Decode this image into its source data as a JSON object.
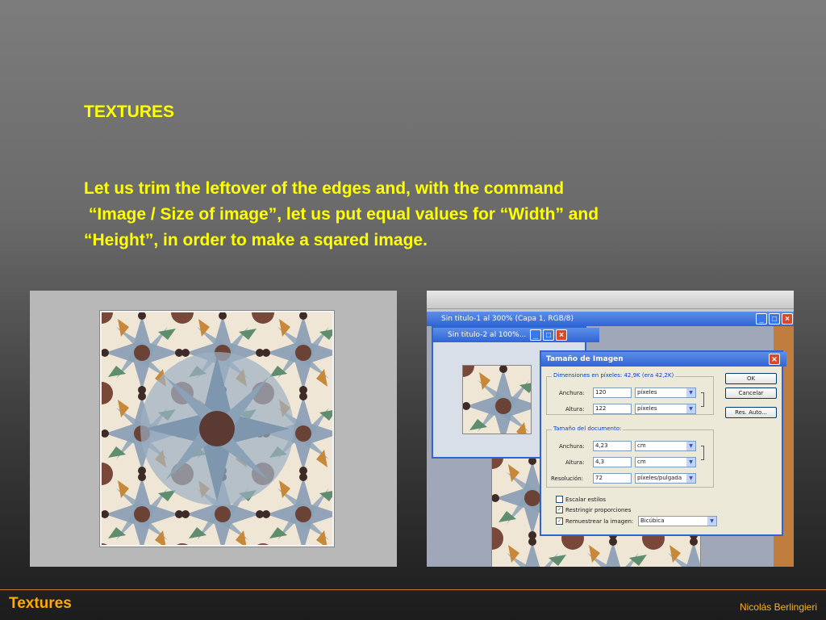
{
  "slide": {
    "title": "TEXTURES",
    "body_lines": [
      "Let us trim the leftover of the edges and, with the command",
      " “Image / Size of image”, let us put equal values for “Width” and",
      "“Height”, in order to make a sqared image."
    ]
  },
  "screenshot": {
    "window1_title": "Sin titulo-1 al 300% (Capa 1, RGB/8)",
    "window2_title": "Sin titulo-2 al 100%...",
    "dialog": {
      "title": "Tamaño de Imagen",
      "pixel_dims_label": "Dimensiones en píxeles: 42,9K (era 42,2K)",
      "width_label": "Anchura:",
      "width_px": "120",
      "height_label": "Altura:",
      "height_px": "122",
      "pixel_unit": "píxeles",
      "doc_size_label": "Tamaño del documento:",
      "doc_width": "4,23",
      "doc_height": "4,3",
      "doc_unit": "cm",
      "resolution_label": "Resolución:",
      "resolution": "72",
      "resolution_unit": "píxeles/pulgada",
      "scale_styles": "Escalar estilos",
      "constrain": "Restringir proporciones",
      "resample": "Remuestrear la imagen:",
      "resample_method": "Bicúbica",
      "ok": "OK",
      "cancel": "Cancelar",
      "auto": "Res. Auto..."
    }
  },
  "footer": {
    "title": "Textures",
    "author": "Nicolás Berlingieri"
  },
  "colors": {
    "text_yellow": "#ffff00",
    "footer_orange": "#ffaa00",
    "titlebar_blue": "#2f64d4"
  }
}
